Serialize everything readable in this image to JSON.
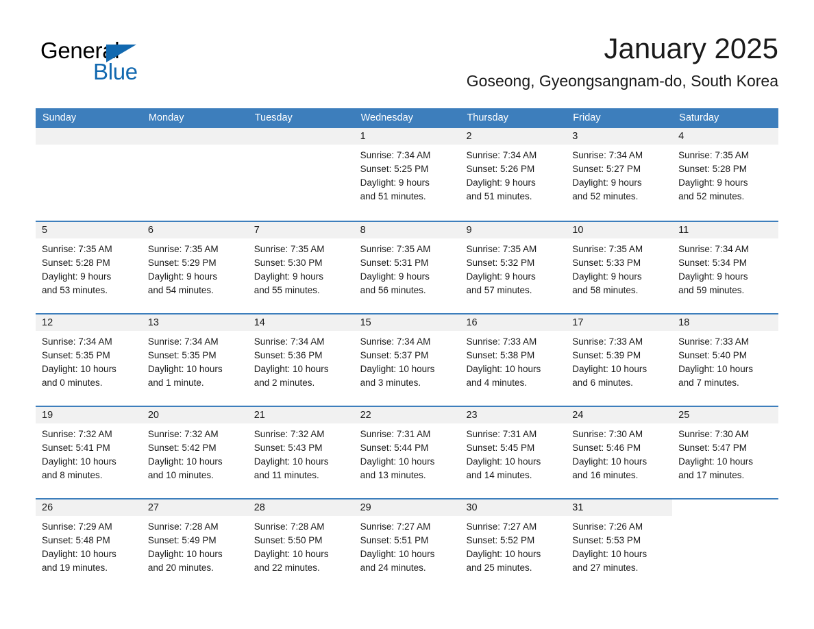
{
  "brand": {
    "name_part1": "General",
    "name_part2": "Blue",
    "triangle_icon": "triangle-icon",
    "accent_color": "#1269b0"
  },
  "header": {
    "month_title": "January 2025",
    "location": "Goseong, Gyeongsangnam-do, South Korea"
  },
  "calendar": {
    "header_bg": "#3d7ebc",
    "day_band_bg": "#f1f1f1",
    "weekday_names": [
      "Sunday",
      "Monday",
      "Tuesday",
      "Wednesday",
      "Thursday",
      "Friday",
      "Saturday"
    ],
    "weeks": [
      [
        {
          "day": "",
          "empty": true
        },
        {
          "day": "",
          "empty": true
        },
        {
          "day": "",
          "empty": true
        },
        {
          "day": "1",
          "sunrise": "Sunrise: 7:34 AM",
          "sunset": "Sunset: 5:25 PM",
          "daylight_line1": "Daylight: 9 hours",
          "daylight_line2": "and 51 minutes."
        },
        {
          "day": "2",
          "sunrise": "Sunrise: 7:34 AM",
          "sunset": "Sunset: 5:26 PM",
          "daylight_line1": "Daylight: 9 hours",
          "daylight_line2": "and 51 minutes."
        },
        {
          "day": "3",
          "sunrise": "Sunrise: 7:34 AM",
          "sunset": "Sunset: 5:27 PM",
          "daylight_line1": "Daylight: 9 hours",
          "daylight_line2": "and 52 minutes."
        },
        {
          "day": "4",
          "sunrise": "Sunrise: 7:35 AM",
          "sunset": "Sunset: 5:28 PM",
          "daylight_line1": "Daylight: 9 hours",
          "daylight_line2": "and 52 minutes."
        }
      ],
      [
        {
          "day": "5",
          "sunrise": "Sunrise: 7:35 AM",
          "sunset": "Sunset: 5:28 PM",
          "daylight_line1": "Daylight: 9 hours",
          "daylight_line2": "and 53 minutes."
        },
        {
          "day": "6",
          "sunrise": "Sunrise: 7:35 AM",
          "sunset": "Sunset: 5:29 PM",
          "daylight_line1": "Daylight: 9 hours",
          "daylight_line2": "and 54 minutes."
        },
        {
          "day": "7",
          "sunrise": "Sunrise: 7:35 AM",
          "sunset": "Sunset: 5:30 PM",
          "daylight_line1": "Daylight: 9 hours",
          "daylight_line2": "and 55 minutes."
        },
        {
          "day": "8",
          "sunrise": "Sunrise: 7:35 AM",
          "sunset": "Sunset: 5:31 PM",
          "daylight_line1": "Daylight: 9 hours",
          "daylight_line2": "and 56 minutes."
        },
        {
          "day": "9",
          "sunrise": "Sunrise: 7:35 AM",
          "sunset": "Sunset: 5:32 PM",
          "daylight_line1": "Daylight: 9 hours",
          "daylight_line2": "and 57 minutes."
        },
        {
          "day": "10",
          "sunrise": "Sunrise: 7:35 AM",
          "sunset": "Sunset: 5:33 PM",
          "daylight_line1": "Daylight: 9 hours",
          "daylight_line2": "and 58 minutes."
        },
        {
          "day": "11",
          "sunrise": "Sunrise: 7:34 AM",
          "sunset": "Sunset: 5:34 PM",
          "daylight_line1": "Daylight: 9 hours",
          "daylight_line2": "and 59 minutes."
        }
      ],
      [
        {
          "day": "12",
          "sunrise": "Sunrise: 7:34 AM",
          "sunset": "Sunset: 5:35 PM",
          "daylight_line1": "Daylight: 10 hours",
          "daylight_line2": "and 0 minutes."
        },
        {
          "day": "13",
          "sunrise": "Sunrise: 7:34 AM",
          "sunset": "Sunset: 5:35 PM",
          "daylight_line1": "Daylight: 10 hours",
          "daylight_line2": "and 1 minute."
        },
        {
          "day": "14",
          "sunrise": "Sunrise: 7:34 AM",
          "sunset": "Sunset: 5:36 PM",
          "daylight_line1": "Daylight: 10 hours",
          "daylight_line2": "and 2 minutes."
        },
        {
          "day": "15",
          "sunrise": "Sunrise: 7:34 AM",
          "sunset": "Sunset: 5:37 PM",
          "daylight_line1": "Daylight: 10 hours",
          "daylight_line2": "and 3 minutes."
        },
        {
          "day": "16",
          "sunrise": "Sunrise: 7:33 AM",
          "sunset": "Sunset: 5:38 PM",
          "daylight_line1": "Daylight: 10 hours",
          "daylight_line2": "and 4 minutes."
        },
        {
          "day": "17",
          "sunrise": "Sunrise: 7:33 AM",
          "sunset": "Sunset: 5:39 PM",
          "daylight_line1": "Daylight: 10 hours",
          "daylight_line2": "and 6 minutes."
        },
        {
          "day": "18",
          "sunrise": "Sunrise: 7:33 AM",
          "sunset": "Sunset: 5:40 PM",
          "daylight_line1": "Daylight: 10 hours",
          "daylight_line2": "and 7 minutes."
        }
      ],
      [
        {
          "day": "19",
          "sunrise": "Sunrise: 7:32 AM",
          "sunset": "Sunset: 5:41 PM",
          "daylight_line1": "Daylight: 10 hours",
          "daylight_line2": "and 8 minutes."
        },
        {
          "day": "20",
          "sunrise": "Sunrise: 7:32 AM",
          "sunset": "Sunset: 5:42 PM",
          "daylight_line1": "Daylight: 10 hours",
          "daylight_line2": "and 10 minutes."
        },
        {
          "day": "21",
          "sunrise": "Sunrise: 7:32 AM",
          "sunset": "Sunset: 5:43 PM",
          "daylight_line1": "Daylight: 10 hours",
          "daylight_line2": "and 11 minutes."
        },
        {
          "day": "22",
          "sunrise": "Sunrise: 7:31 AM",
          "sunset": "Sunset: 5:44 PM",
          "daylight_line1": "Daylight: 10 hours",
          "daylight_line2": "and 13 minutes."
        },
        {
          "day": "23",
          "sunrise": "Sunrise: 7:31 AM",
          "sunset": "Sunset: 5:45 PM",
          "daylight_line1": "Daylight: 10 hours",
          "daylight_line2": "and 14 minutes."
        },
        {
          "day": "24",
          "sunrise": "Sunrise: 7:30 AM",
          "sunset": "Sunset: 5:46 PM",
          "daylight_line1": "Daylight: 10 hours",
          "daylight_line2": "and 16 minutes."
        },
        {
          "day": "25",
          "sunrise": "Sunrise: 7:30 AM",
          "sunset": "Sunset: 5:47 PM",
          "daylight_line1": "Daylight: 10 hours",
          "daylight_line2": "and 17 minutes."
        }
      ],
      [
        {
          "day": "26",
          "sunrise": "Sunrise: 7:29 AM",
          "sunset": "Sunset: 5:48 PM",
          "daylight_line1": "Daylight: 10 hours",
          "daylight_line2": "and 19 minutes."
        },
        {
          "day": "27",
          "sunrise": "Sunrise: 7:28 AM",
          "sunset": "Sunset: 5:49 PM",
          "daylight_line1": "Daylight: 10 hours",
          "daylight_line2": "and 20 minutes."
        },
        {
          "day": "28",
          "sunrise": "Sunrise: 7:28 AM",
          "sunset": "Sunset: 5:50 PM",
          "daylight_line1": "Daylight: 10 hours",
          "daylight_line2": "and 22 minutes."
        },
        {
          "day": "29",
          "sunrise": "Sunrise: 7:27 AM",
          "sunset": "Sunset: 5:51 PM",
          "daylight_line1": "Daylight: 10 hours",
          "daylight_line2": "and 24 minutes."
        },
        {
          "day": "30",
          "sunrise": "Sunrise: 7:27 AM",
          "sunset": "Sunset: 5:52 PM",
          "daylight_line1": "Daylight: 10 hours",
          "daylight_line2": "and 25 minutes."
        },
        {
          "day": "31",
          "sunrise": "Sunrise: 7:26 AM",
          "sunset": "Sunset: 5:53 PM",
          "daylight_line1": "Daylight: 10 hours",
          "daylight_line2": "and 27 minutes."
        },
        {
          "day": "",
          "empty": true,
          "no_band": true
        }
      ]
    ]
  }
}
